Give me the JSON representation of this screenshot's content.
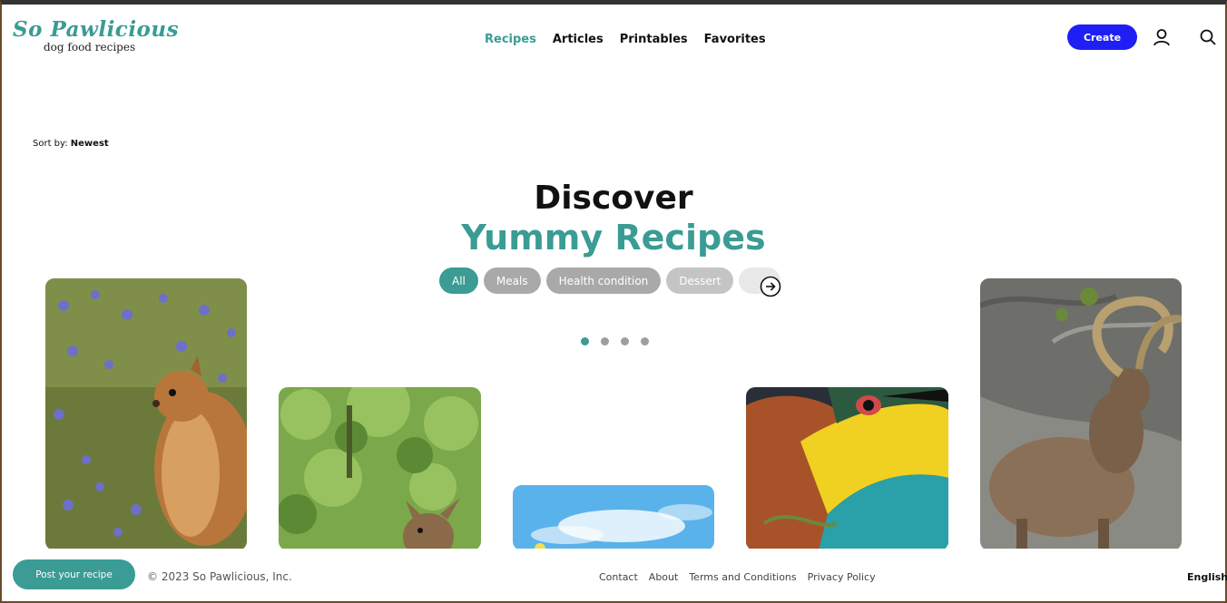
{
  "logo": {
    "name": "So Pawlicious",
    "tagline": "dog food recipes"
  },
  "nav": {
    "items": [
      {
        "label": "Recipes",
        "active": true
      },
      {
        "label": "Articles",
        "active": false
      },
      {
        "label": "Printables",
        "active": false
      },
      {
        "label": "Favorites",
        "active": false
      }
    ]
  },
  "header": {
    "create_label": "Create",
    "user_icon": "user-icon",
    "search_icon": "search-icon"
  },
  "sort": {
    "label": "Sort by:",
    "value": "Newest"
  },
  "hero": {
    "line1": "Discover",
    "line2": "Yummy Recipes"
  },
  "filters": [
    "All",
    "Meals",
    "Health condition",
    "Dessert"
  ],
  "carousel": {
    "pages": 4,
    "active_page": 1
  },
  "footer": {
    "post_label": "Post your recipe",
    "copyright": "© 2023 So Pawlicious, Inc.",
    "links": [
      "Contact",
      "About",
      "Terms and Conditions",
      "Privacy Policy"
    ],
    "language": "English"
  },
  "colors": {
    "accent": "#3a9c94",
    "create": "#1f1ff5",
    "chip": "#a9a9a9"
  }
}
